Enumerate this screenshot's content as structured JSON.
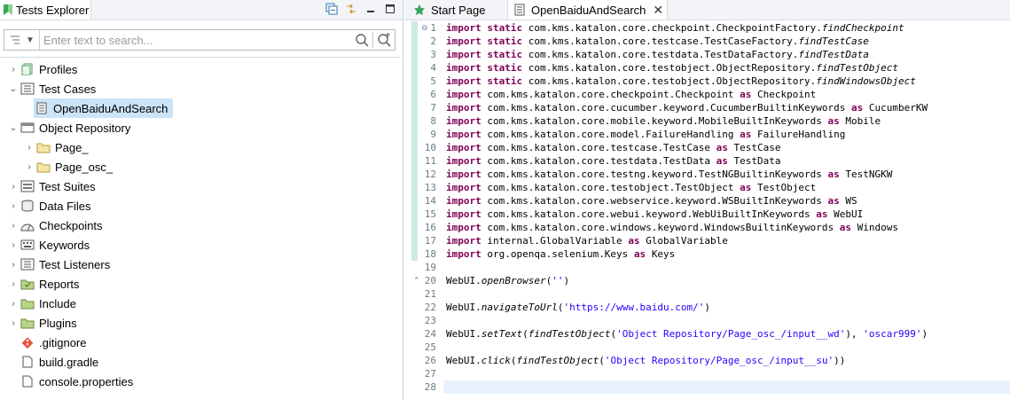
{
  "left_panel": {
    "tab_title": "Tests Explorer",
    "search_placeholder": "Enter text to search...",
    "tree": [
      {
        "label": "Profiles",
        "icon": "profiles-icon"
      },
      {
        "label": "Test Cases",
        "icon": "test-cases-icon"
      },
      {
        "label": "OpenBaiduAndSearch",
        "icon": "test-case-file-icon"
      },
      {
        "label": "Object Repository",
        "icon": "object-repository-icon"
      },
      {
        "label": "Page_",
        "icon": "folder-icon"
      },
      {
        "label": "Page_osc_",
        "icon": "folder-icon"
      },
      {
        "label": "Test Suites",
        "icon": "test-suites-icon"
      },
      {
        "label": "Data Files",
        "icon": "data-files-icon"
      },
      {
        "label": "Checkpoints",
        "icon": "checkpoints-icon"
      },
      {
        "label": "Keywords",
        "icon": "keywords-icon"
      },
      {
        "label": "Test Listeners",
        "icon": "test-listeners-icon"
      },
      {
        "label": "Reports",
        "icon": "reports-icon"
      },
      {
        "label": "Include",
        "icon": "folder-icon"
      },
      {
        "label": "Plugins",
        "icon": "folder-icon"
      },
      {
        "label": ".gitignore",
        "icon": "git-icon"
      },
      {
        "label": "build.gradle",
        "icon": "file-icon"
      },
      {
        "label": "console.properties",
        "icon": "file-icon"
      }
    ]
  },
  "editor": {
    "tabs": [
      {
        "label": "Start Page"
      },
      {
        "label": "OpenBaiduAndSearch"
      }
    ],
    "line_numbers": [
      "1",
      "2",
      "3",
      "4",
      "5",
      "6",
      "7",
      "8",
      "9",
      "10",
      "11",
      "12",
      "13",
      "14",
      "15",
      "16",
      "17",
      "18",
      "19",
      "20",
      "21",
      "22",
      "23",
      "24",
      "25",
      "26",
      "27",
      "28"
    ],
    "lines": [
      [
        {
          "t": "import static ",
          "c": "kw"
        },
        {
          "t": "com.kms.katalon.core.checkpoint.CheckpointFactory."
        },
        {
          "t": "findCheckpoint",
          "c": "it"
        }
      ],
      [
        {
          "t": "import static ",
          "c": "kw"
        },
        {
          "t": "com.kms.katalon.core.testcase.TestCaseFactory."
        },
        {
          "t": "findTestCase",
          "c": "it"
        }
      ],
      [
        {
          "t": "import static ",
          "c": "kw"
        },
        {
          "t": "com.kms.katalon.core.testdata.TestDataFactory."
        },
        {
          "t": "findTestData",
          "c": "it"
        }
      ],
      [
        {
          "t": "import static ",
          "c": "kw"
        },
        {
          "t": "com.kms.katalon.core.testobject.ObjectRepository."
        },
        {
          "t": "findTestObject",
          "c": "it"
        }
      ],
      [
        {
          "t": "import static ",
          "c": "kw"
        },
        {
          "t": "com.kms.katalon.core.testobject.ObjectRepository."
        },
        {
          "t": "findWindowsObject",
          "c": "it"
        }
      ],
      [
        {
          "t": "import ",
          "c": "kw"
        },
        {
          "t": "com.kms.katalon.core.checkpoint.Checkpoint "
        },
        {
          "t": "as ",
          "c": "kw"
        },
        {
          "t": "Checkpoint"
        }
      ],
      [
        {
          "t": "import ",
          "c": "kw"
        },
        {
          "t": "com.kms.katalon.core.cucumber.keyword.CucumberBuiltinKeywords "
        },
        {
          "t": "as ",
          "c": "kw"
        },
        {
          "t": "CucumberKW"
        }
      ],
      [
        {
          "t": "import ",
          "c": "kw"
        },
        {
          "t": "com.kms.katalon.core.mobile.keyword.MobileBuiltInKeywords "
        },
        {
          "t": "as ",
          "c": "kw"
        },
        {
          "t": "Mobile"
        }
      ],
      [
        {
          "t": "import ",
          "c": "kw"
        },
        {
          "t": "com.kms.katalon.core.model.FailureHandling "
        },
        {
          "t": "as ",
          "c": "kw"
        },
        {
          "t": "FailureHandling"
        }
      ],
      [
        {
          "t": "import ",
          "c": "kw"
        },
        {
          "t": "com.kms.katalon.core.testcase.TestCase "
        },
        {
          "t": "as ",
          "c": "kw"
        },
        {
          "t": "TestCase"
        }
      ],
      [
        {
          "t": "import ",
          "c": "kw"
        },
        {
          "t": "com.kms.katalon.core.testdata.TestData "
        },
        {
          "t": "as ",
          "c": "kw"
        },
        {
          "t": "TestData"
        }
      ],
      [
        {
          "t": "import ",
          "c": "kw"
        },
        {
          "t": "com.kms.katalon.core.testng.keyword.TestNGBuiltinKeywords "
        },
        {
          "t": "as ",
          "c": "kw"
        },
        {
          "t": "TestNGKW"
        }
      ],
      [
        {
          "t": "import ",
          "c": "kw"
        },
        {
          "t": "com.kms.katalon.core.testobject.TestObject "
        },
        {
          "t": "as ",
          "c": "kw"
        },
        {
          "t": "TestObject"
        }
      ],
      [
        {
          "t": "import ",
          "c": "kw"
        },
        {
          "t": "com.kms.katalon.core.webservice.keyword.WSBuiltInKeywords "
        },
        {
          "t": "as ",
          "c": "kw"
        },
        {
          "t": "WS"
        }
      ],
      [
        {
          "t": "import ",
          "c": "kw"
        },
        {
          "t": "com.kms.katalon.core.webui.keyword.WebUiBuiltInKeywords "
        },
        {
          "t": "as ",
          "c": "kw"
        },
        {
          "t": "WebUI"
        }
      ],
      [
        {
          "t": "import ",
          "c": "kw"
        },
        {
          "t": "com.kms.katalon.core.windows.keyword.WindowsBuiltinKeywords "
        },
        {
          "t": "as ",
          "c": "kw"
        },
        {
          "t": "Windows"
        }
      ],
      [
        {
          "t": "import ",
          "c": "kw"
        },
        {
          "t": "internal.GlobalVariable "
        },
        {
          "t": "as ",
          "c": "kw"
        },
        {
          "t": "GlobalVariable"
        }
      ],
      [
        {
          "t": "import ",
          "c": "kw"
        },
        {
          "t": "org.openqa.selenium.Keys "
        },
        {
          "t": "as ",
          "c": "kw"
        },
        {
          "t": "Keys"
        }
      ],
      [],
      [
        {
          "t": "WebUI."
        },
        {
          "t": "openBrowser",
          "c": "it"
        },
        {
          "t": "("
        },
        {
          "t": "''",
          "c": "str"
        },
        {
          "t": ")"
        }
      ],
      [],
      [
        {
          "t": "WebUI."
        },
        {
          "t": "navigateToUrl",
          "c": "it"
        },
        {
          "t": "("
        },
        {
          "t": "'https://www.baidu.com/'",
          "c": "str"
        },
        {
          "t": ")"
        }
      ],
      [],
      [
        {
          "t": "WebUI."
        },
        {
          "t": "setText",
          "c": "it"
        },
        {
          "t": "("
        },
        {
          "t": "findTestObject",
          "c": "it"
        },
        {
          "t": "("
        },
        {
          "t": "'Object Repository/Page_osc_/input__wd'",
          "c": "str"
        },
        {
          "t": "), "
        },
        {
          "t": "'oscar999'",
          "c": "str"
        },
        {
          "t": ")"
        }
      ],
      [],
      [
        {
          "t": "WebUI."
        },
        {
          "t": "click",
          "c": "it"
        },
        {
          "t": "("
        },
        {
          "t": "findTestObject",
          "c": "it"
        },
        {
          "t": "("
        },
        {
          "t": "'Object Repository/Page_osc_/input__su'",
          "c": "str"
        },
        {
          "t": "))"
        }
      ],
      [],
      []
    ]
  },
  "colors": {
    "keyword": "#7f0055",
    "string": "#2a00ff",
    "line_number": "#6c7a89",
    "selection": "#cce4f7",
    "current_line": "#e8f2fe"
  }
}
